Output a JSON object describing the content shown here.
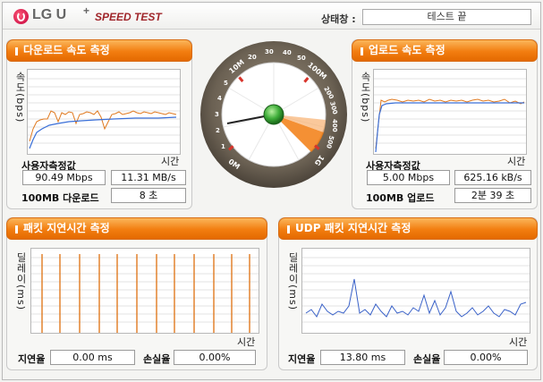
{
  "header": {
    "brand": "LG U",
    "brand_plus": "+",
    "product": "SPEED TEST",
    "status_label": "상태창 :",
    "status_value": "테스트 끝"
  },
  "download": {
    "title": "다운로드 속도 측정",
    "ylabel": "속도(bps)",
    "xlabel": "시간",
    "user_label": "사용자측정값",
    "mbps": "90.49 Mbps",
    "mbs": "11.31 MB/s",
    "mb100_label": "100MB 다운로드",
    "mb100_value": "8 초"
  },
  "upload": {
    "title": "업로드 속도 측정",
    "ylabel": "속도(bps)",
    "xlabel": "시간",
    "user_label": "사용자측정값",
    "mbps": "5.00 Mbps",
    "kbs": "625.16 kB/s",
    "mb100_label": "100MB 업로드",
    "mb100_value": "2분 39 초"
  },
  "packet": {
    "title": "패킷 지연시간 측정",
    "ylabel": "딜레이(ms)",
    "xlabel": "시간",
    "delay_label": "지연율",
    "delay_value": "0.00 ms",
    "loss_label": "손실율",
    "loss_value": "0.00%"
  },
  "udp": {
    "title": "UDP 패킷 지연시간 측정",
    "ylabel": "딜레이(ms)",
    "xlabel": "시간",
    "delay_label": "지연율",
    "delay_value": "13.80 ms",
    "loss_label": "손실율",
    "loss_value": "0.00%"
  },
  "gauge": {
    "ticks": [
      "0M",
      "1",
      "2",
      "3",
      "4",
      "5",
      "10M",
      "20",
      "30",
      "40",
      "50",
      "100M",
      "200",
      "300",
      "400",
      "500",
      "1G"
    ]
  },
  "colors": {
    "accent": "#f27d10",
    "download_line": "#3a6fd8",
    "measure_line": "#e07a20",
    "udp_line": "#3a62c8"
  }
}
